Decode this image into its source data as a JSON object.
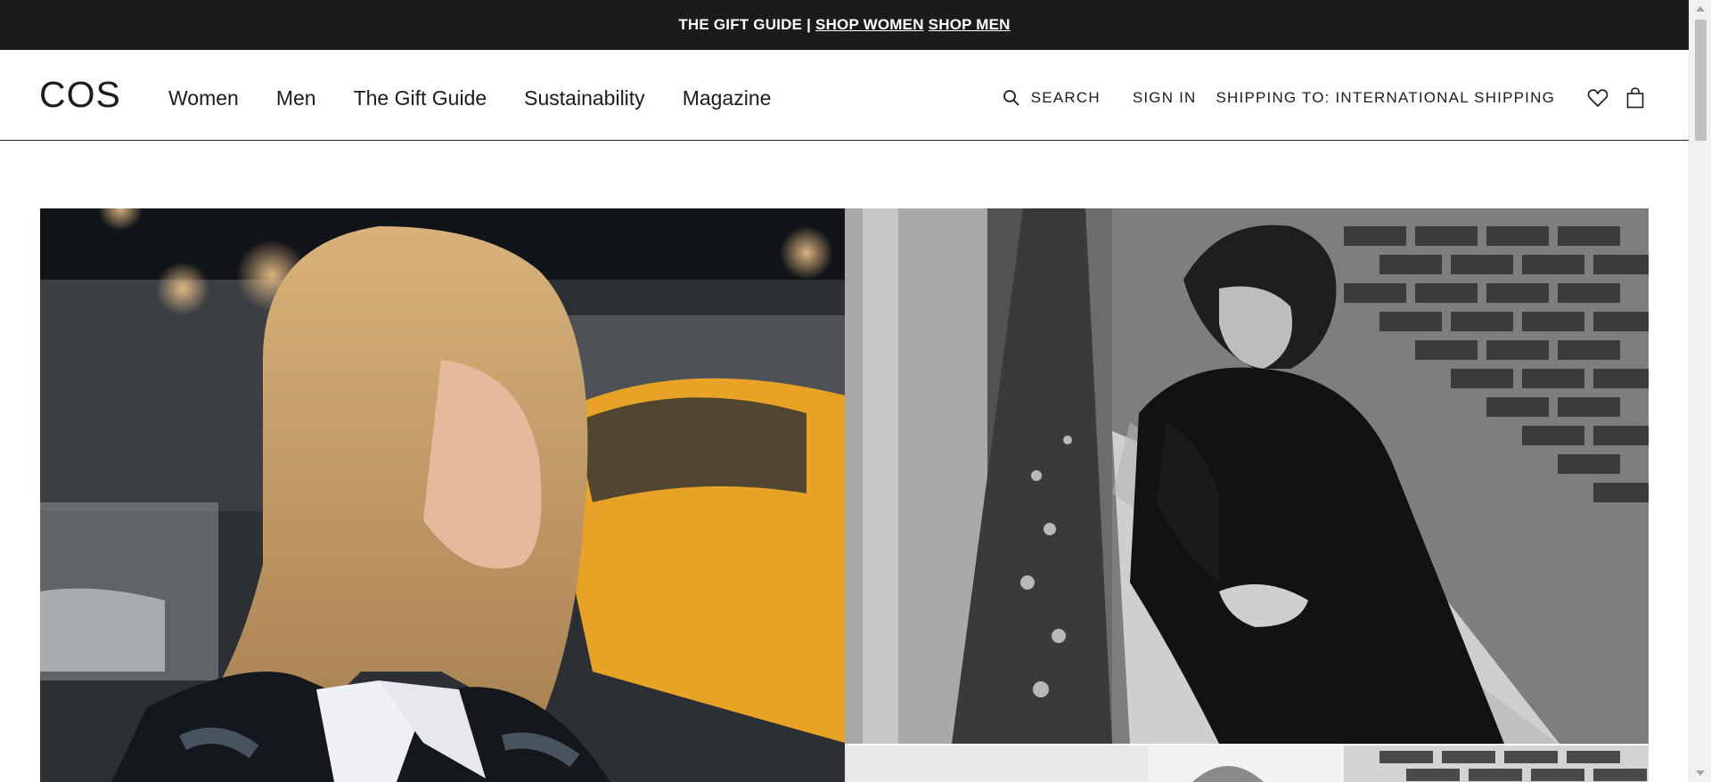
{
  "promo": {
    "text": "THE GIFT GUIDE |",
    "link_women": "SHOP WOMEN",
    "link_men": "SHOP MEN"
  },
  "header": {
    "logo": "COS",
    "nav": [
      "Women",
      "Men",
      "The Gift Guide",
      "Sustainability",
      "Magazine"
    ],
    "search_label": "SEARCH",
    "signin_label": "SIGN IN",
    "shipping_label": "SHIPPING TO: INTERNATIONAL SHIPPING",
    "icons": [
      "search-icon",
      "heart-icon",
      "shopping-bag-icon"
    ]
  },
  "colors": {
    "promo_background": "#1b1b1b",
    "text": "#1c1c1c",
    "taxi_yellow": "#e8a326"
  }
}
